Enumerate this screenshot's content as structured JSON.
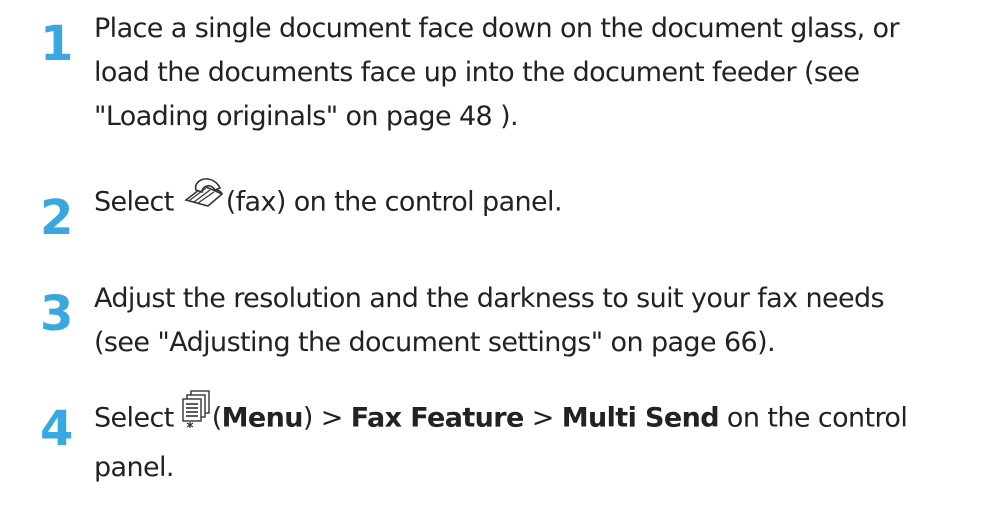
{
  "steps": [
    {
      "number": "1",
      "lines": [
        "Place a single document face down on the document glass, or",
        "load the documents face up into the document feeder (see",
        "\"Loading originals\" on page 48 )."
      ]
    },
    {
      "number": "2",
      "before": "Select ",
      "icon": "fax-icon",
      "after": "(fax) on the control panel."
    },
    {
      "number": "3",
      "lines": [
        "Adjust the resolution and the darkness to suit your fax needs",
        "(see \"Adjusting the document settings\" on page 66)."
      ]
    },
    {
      "number": "4",
      "before": "Select ",
      "icon": "menu-icon",
      "paren_open": "(",
      "menu": "Menu",
      "paren_close": ") > ",
      "fax_feature": "Fax Feature",
      "sep": " > ",
      "multi_send": "Multi Send",
      "after": " on the control",
      "line2": "panel."
    }
  ],
  "colors": {
    "step_number": "#3aa8e0",
    "text": "#222222"
  }
}
